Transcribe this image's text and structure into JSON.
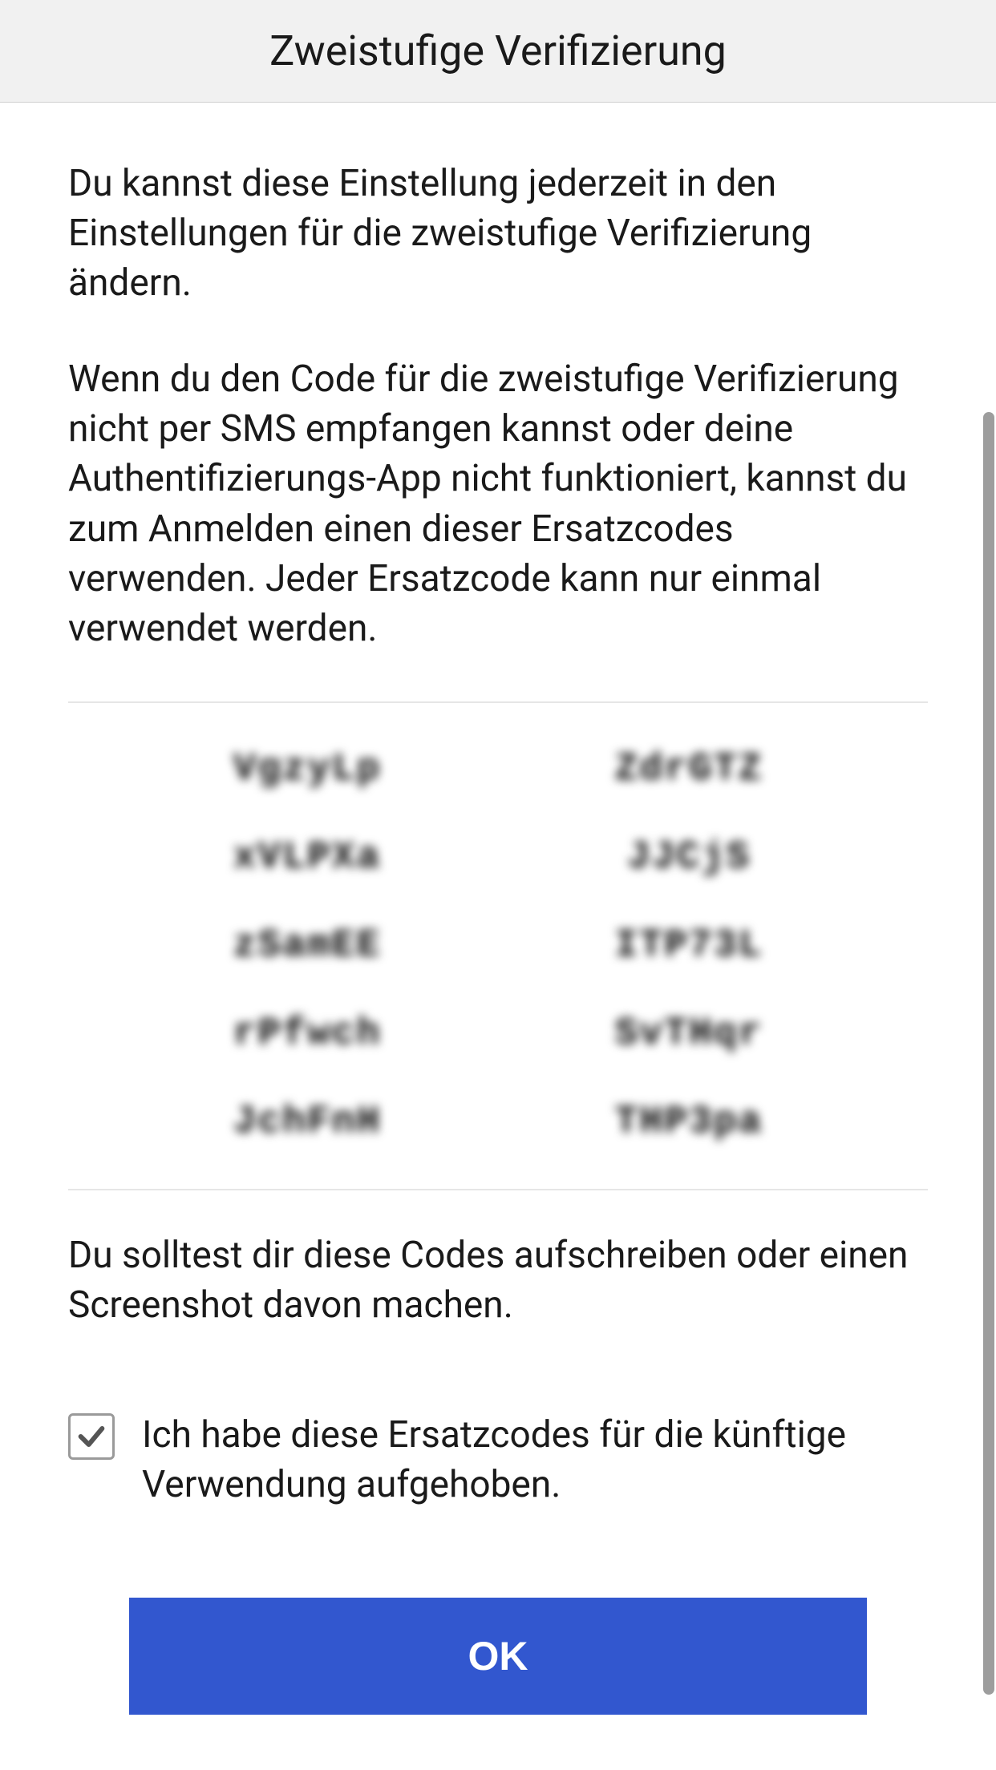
{
  "header": {
    "title": "Zweistufige Verifizierung"
  },
  "body": {
    "paragraph1": "Du kannst diese Einstellung jederzeit in den Einstellungen für die zweistufige Verifizierung ändern.",
    "paragraph2": "Wenn du den Code für die zweistufige Verifizierung nicht per SMS empfangen kannst oder deine Authentifizierungs-App nicht funktioniert, kannst du zum Anmelden einen dieser Ersatzcodes verwenden. Jeder Ersatzcode kann nur einmal verwendet werden."
  },
  "codes": {
    "left": [
      "VgzyLp",
      "xVLPXa",
      "zSamEE",
      "rPfwch",
      "JchFnH"
    ],
    "right": [
      "ZdrGTZ",
      "JJCjS",
      "ITP73L",
      "SvTHqr",
      "THP3pa"
    ]
  },
  "advice": "Du solltest dir diese Codes aufschreiben oder einen Screenshot davon machen.",
  "confirm": {
    "checked": true,
    "label": "Ich habe diese Ersatzcodes für die künftige Verwendung aufgehoben."
  },
  "ok_label": "OK",
  "colors": {
    "primary_button": "#3257cf",
    "header_bg": "#f1f1f1"
  }
}
